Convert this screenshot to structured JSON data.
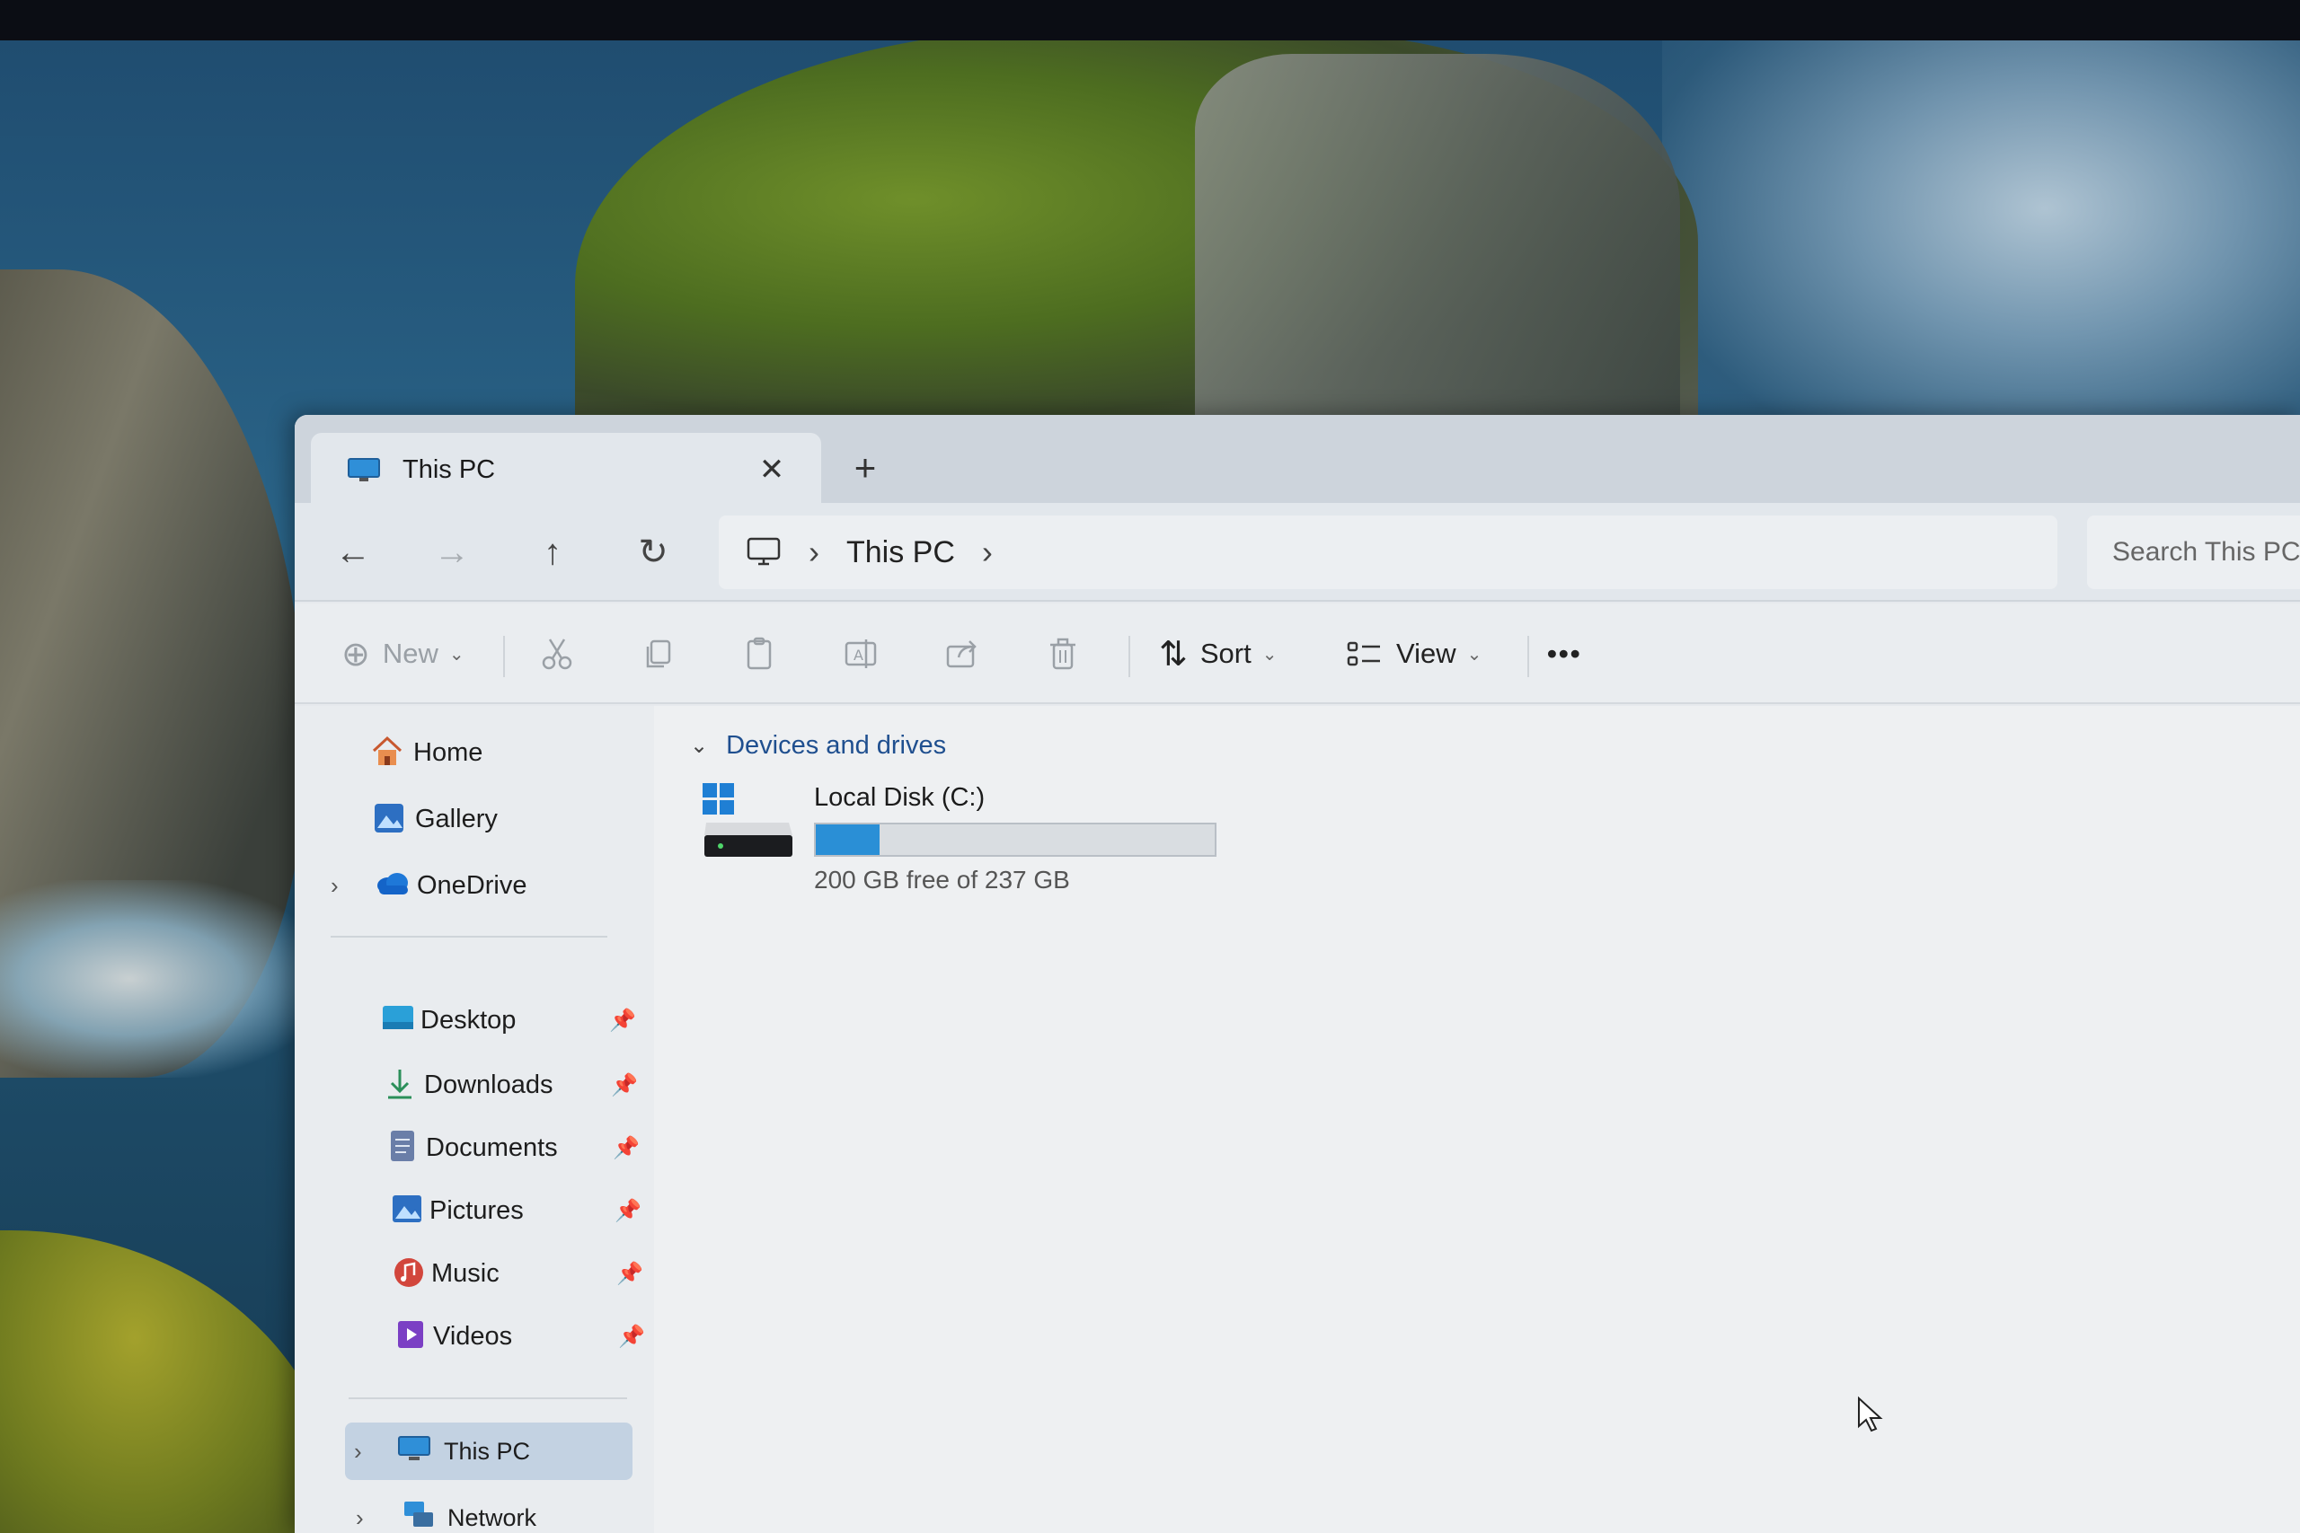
{
  "window": {
    "tab_title": "This PC",
    "tab_close_icon": "✕",
    "new_tab_icon": "+"
  },
  "navigation": {
    "back_icon": "←",
    "forward_icon": "→",
    "up_icon": "↑",
    "refresh_icon": "↻",
    "breadcrumb": [
      "This PC"
    ],
    "breadcrumb_separator": "›",
    "search_placeholder": "Search This PC"
  },
  "toolbar": {
    "new_label": "New",
    "sort_label": "Sort",
    "view_label": "View",
    "more_label": "•••"
  },
  "sidebar": {
    "quick": [
      {
        "label": "Home",
        "icon": "home-icon"
      },
      {
        "label": "Gallery",
        "icon": "gallery-icon"
      },
      {
        "label": "OneDrive",
        "icon": "onedrive-icon"
      }
    ],
    "pinned": [
      {
        "label": "Desktop",
        "icon": "desktop-icon"
      },
      {
        "label": "Downloads",
        "icon": "downloads-icon"
      },
      {
        "label": "Documents",
        "icon": "documents-icon"
      },
      {
        "label": "Pictures",
        "icon": "pictures-icon"
      },
      {
        "label": "Music",
        "icon": "music-icon"
      },
      {
        "label": "Videos",
        "icon": "videos-icon"
      }
    ],
    "locations": [
      {
        "label": "This PC",
        "icon": "computer-icon",
        "selected": true
      },
      {
        "label": "Network",
        "icon": "network-icon"
      }
    ]
  },
  "content": {
    "group_header": "Devices and drives",
    "drives": [
      {
        "name": "Local Disk (C:)",
        "free_text": "200 GB free of 237 GB",
        "used_fraction": 0.16
      }
    ]
  },
  "colors": {
    "accent": "#2a8fd6",
    "selection": "#c3d2e2",
    "link": "#1f4f8f"
  }
}
